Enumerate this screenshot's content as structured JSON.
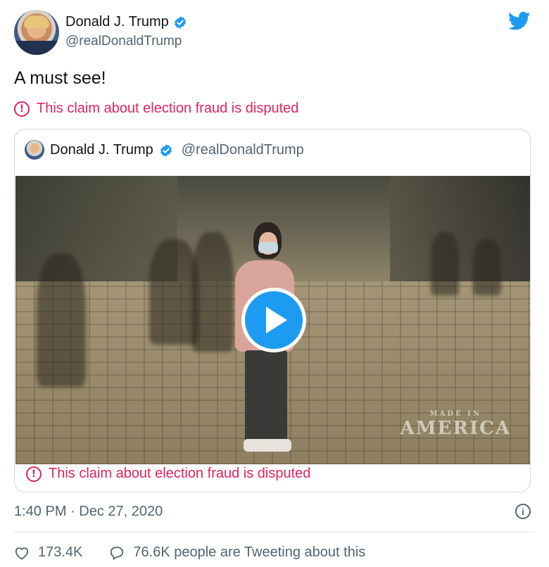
{
  "author": {
    "name": "Donald J. Trump",
    "handle": "@realDonaldTrump"
  },
  "tweet": {
    "text": "A must see!",
    "disputed_notice": "This claim about election fraud is disputed"
  },
  "quoted_tweet": {
    "name": "Donald J. Trump",
    "handle": "@realDonaldTrump",
    "media_watermark_small": "MADE IN",
    "media_watermark": "AMERICA",
    "disputed_notice": "This claim about election fraud is disputed"
  },
  "meta": {
    "timestamp": "1:40 PM · Dec 27, 2020"
  },
  "actions": {
    "likes": "173.4K",
    "conversation": "76.6K people are Tweeting about this"
  },
  "icons": {
    "verified": "verified-badge-icon",
    "brand": "twitter-bird-icon",
    "alert": "alert-circle-icon",
    "play": "play-icon",
    "info": "info-icon",
    "like": "heart-icon",
    "reply": "reply-icon"
  },
  "colors": {
    "twitter_blue": "#1d9bf0",
    "dispute_red": "#e0245e",
    "secondary_text": "#536471"
  }
}
